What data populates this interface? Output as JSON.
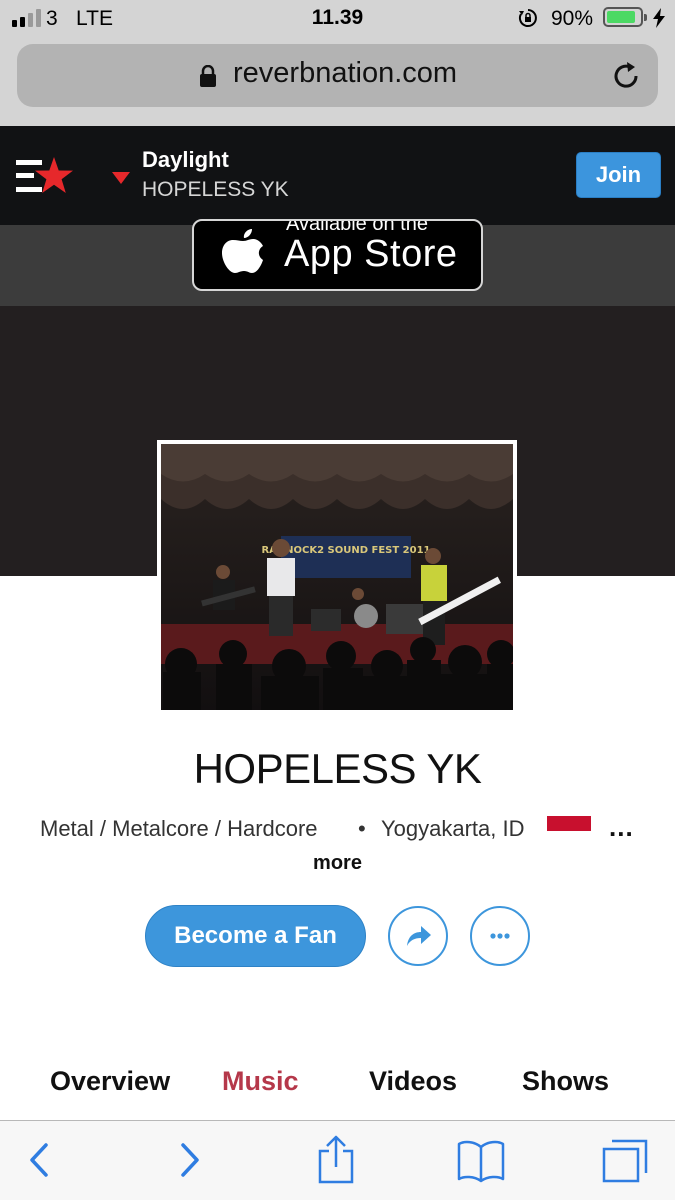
{
  "status_bar": {
    "carrier": "3",
    "network": "LTE",
    "time": "11.39",
    "battery_percent": "90%",
    "battery_level": 0.9
  },
  "browser": {
    "url": "reverbnation.com"
  },
  "header": {
    "now_playing_title": "Daylight",
    "now_playing_artist": "HOPELESS YK",
    "join_label": "Join"
  },
  "promo": {
    "small_text": "Available on the",
    "store_name": "App Store"
  },
  "profile": {
    "artist_name": "HOPELESS YK",
    "genres": "Metal / Metalcore / Hardcore",
    "separator": "•",
    "location": "Yogyakarta, ID",
    "more_dots": "...",
    "more_label": "more",
    "fan_button": "Become a Fan",
    "photo_banner": "RAGNOCK2 SOUND FEST 2011"
  },
  "tabs": [
    {
      "label": "Overview",
      "active": false
    },
    {
      "label": "Music",
      "active": true
    },
    {
      "label": "Videos",
      "active": false
    },
    {
      "label": "Shows",
      "active": false
    }
  ],
  "colors": {
    "accent_blue": "#3d96dc",
    "active_tab": "#b5384a",
    "header_bg": "#111214",
    "logo_red": "#e6282b",
    "flag_red": "#c8102e"
  }
}
